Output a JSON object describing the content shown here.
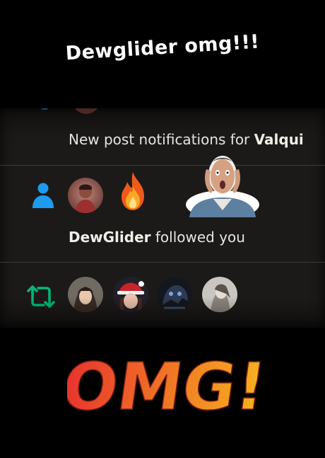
{
  "caption": {
    "text": "Dewglider omg!!!"
  },
  "notifications": {
    "post_notice": {
      "prefix": "New post notifications for ",
      "name": "Valqui"
    },
    "follow": {
      "user": "DewGlider",
      "action": " followed you"
    }
  },
  "sticker_text": "OMG!",
  "colors": {
    "background": "#000000",
    "panel": "#1c1a18",
    "text": "#e7e5e1",
    "person_icon": "#1d9bf0",
    "repost_icon": "#00ba7c",
    "omg_gradient": [
      "#e8322e",
      "#f07b24",
      "#f6b41f"
    ]
  },
  "icons": [
    "person-icon",
    "fire-emoji-icon",
    "repost-icon",
    "shocked-face-sticker"
  ]
}
